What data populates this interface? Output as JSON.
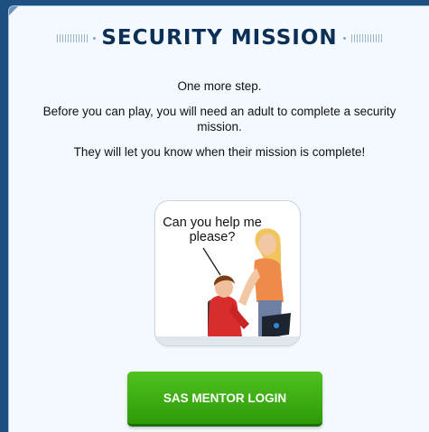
{
  "header": {
    "title": "SECURITY MISSION"
  },
  "content": {
    "line1": "One more step.",
    "line2": "Before you can play, you will need an adult to complete a security mission.",
    "line3": "They will let you know when their mission is complete!"
  },
  "illustration": {
    "speech": "Can you help me please?"
  },
  "button": {
    "label": "SAS MENTOR LOGIN"
  },
  "colors": {
    "title": "#0c2f55",
    "button": "#3aaa12",
    "panel": "#f3f9ff",
    "frame": "#1d4f80"
  }
}
